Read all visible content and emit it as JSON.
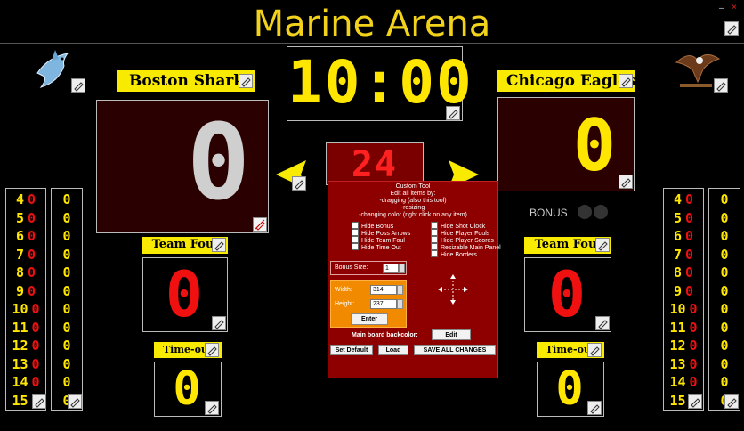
{
  "title": "Marine Arena",
  "window_controls": {
    "minimize": "–",
    "close": "×"
  },
  "clock": "10:00",
  "shot_clock": "24",
  "home": {
    "name": "Boston Sharks",
    "score": "0",
    "team_foul_label": "Team Foul",
    "team_fouls": "0",
    "timeout_label": "Time-out",
    "timeouts": "0",
    "players": [
      {
        "no": "4",
        "v": "0",
        "f": "0"
      },
      {
        "no": "5",
        "v": "0",
        "f": "0"
      },
      {
        "no": "6",
        "v": "0",
        "f": "0"
      },
      {
        "no": "7",
        "v": "0",
        "f": "0"
      },
      {
        "no": "8",
        "v": "0",
        "f": "0"
      },
      {
        "no": "9",
        "v": "0",
        "f": "0"
      },
      {
        "no": "10",
        "v": "0",
        "f": "0"
      },
      {
        "no": "11",
        "v": "0",
        "f": "0"
      },
      {
        "no": "12",
        "v": "0",
        "f": "0"
      },
      {
        "no": "13",
        "v": "0",
        "f": "0"
      },
      {
        "no": "14",
        "v": "0",
        "f": "0"
      },
      {
        "no": "15",
        "v": "0",
        "f": "0"
      }
    ]
  },
  "guest": {
    "name": "Chicago Eagles",
    "score": "0",
    "team_foul_label": "Team Foul",
    "team_fouls": "0",
    "timeout_label": "Time-out",
    "timeouts": "0",
    "bonus_label": "BONUS",
    "players": [
      {
        "no": "4",
        "v": "0",
        "f": "0"
      },
      {
        "no": "5",
        "v": "0",
        "f": "0"
      },
      {
        "no": "6",
        "v": "0",
        "f": "0"
      },
      {
        "no": "7",
        "v": "0",
        "f": "0"
      },
      {
        "no": "8",
        "v": "0",
        "f": "0"
      },
      {
        "no": "9",
        "v": "0",
        "f": "0"
      },
      {
        "no": "10",
        "v": "0",
        "f": "0"
      },
      {
        "no": "11",
        "v": "0",
        "f": "0"
      },
      {
        "no": "12",
        "v": "0",
        "f": "0"
      },
      {
        "no": "13",
        "v": "0",
        "f": "0"
      },
      {
        "no": "14",
        "v": "0",
        "f": "0"
      },
      {
        "no": "15",
        "v": "0",
        "f": "0"
      }
    ]
  },
  "custom_tool": {
    "title": "Custom Tool",
    "lines": [
      "Edit all items by:",
      "-dragging (also this tool)",
      "-resizing",
      "-changing color (right click on any item)"
    ],
    "options_left": [
      "Hide Bonus",
      "Hide Poss Arrows",
      "Hide Team Foul",
      "Hide Time Out"
    ],
    "options_right": [
      "Hide Shot Clock",
      "Hide Player Fouls",
      "Hide Player Scores",
      "Resizable Main Panel",
      "Hide Borders"
    ],
    "bonus_size_label": "Bonus Size:",
    "bonus_size_value": "1",
    "width_label": "Width:",
    "width_value": "314",
    "height_label": "Height:",
    "height_value": "237",
    "enter_label": "Enter",
    "backcolor_label": "Main board backcolor:",
    "edit_label": "Edit",
    "set_default_label": "Set Default",
    "load_label": "Load",
    "save_label": "SAVE ALL CHANGES"
  },
  "colors": {
    "accent_yellow": "#f8ea00",
    "title_yellow": "#f2d21b",
    "panel_red": "#8e0000",
    "digit_red": "#f01010"
  },
  "icons": {
    "edit": "pencil-icon",
    "home_logo": "shark-icon",
    "guest_logo": "eagle-icon"
  }
}
